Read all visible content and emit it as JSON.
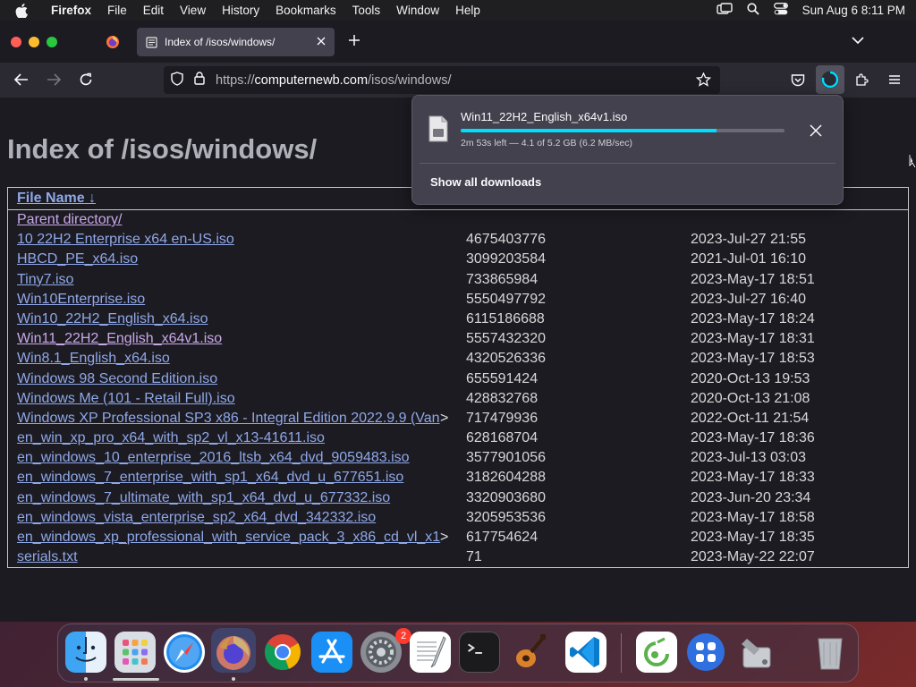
{
  "menubar": {
    "app_name": "Firefox",
    "items": [
      "File",
      "Edit",
      "View",
      "History",
      "Bookmarks",
      "Tools",
      "Window",
      "Help"
    ],
    "clock": "Sun Aug 6  8:11 PM"
  },
  "browser": {
    "tab_title": "Index of /isos/windows/",
    "url_scheme": "https://",
    "url_host": "computernewb.com",
    "url_path": "/isos/windows/"
  },
  "page": {
    "title": "Index of /isos/windows/",
    "column_file_name": "File Name",
    "sort_indicator": "↓",
    "parent_link": "Parent directory/",
    "truncation_marker": ">",
    "rows": [
      {
        "name": "10 22H2 Enterprise x64 en-US.iso",
        "size": "4675403776",
        "date": "2023-Jul-27 21:55",
        "visited": false,
        "truncated": false
      },
      {
        "name": "HBCD_PE_x64.iso",
        "size": "3099203584",
        "date": "2021-Jul-01 16:10",
        "visited": false,
        "truncated": false
      },
      {
        "name": "Tiny7.iso",
        "size": "733865984",
        "date": "2023-May-17 18:51",
        "visited": false,
        "truncated": false
      },
      {
        "name": "Win10Enterprise.iso",
        "size": "5550497792",
        "date": "2023-Jul-27 16:40",
        "visited": false,
        "truncated": false
      },
      {
        "name": "Win10_22H2_English_x64.iso",
        "size": "6115186688",
        "date": "2023-May-17 18:24",
        "visited": false,
        "truncated": false
      },
      {
        "name": "Win11_22H2_English_x64v1.iso",
        "size": "5557432320",
        "date": "2023-May-17 18:31",
        "visited": true,
        "truncated": false
      },
      {
        "name": "Win8.1_English_x64.iso",
        "size": "4320526336",
        "date": "2023-May-17 18:53",
        "visited": false,
        "truncated": false
      },
      {
        "name": "Windows 98 Second Edition.iso",
        "size": "655591424",
        "date": "2020-Oct-13 19:53",
        "visited": false,
        "truncated": false
      },
      {
        "name": "Windows Me (101 - Retail Full).iso",
        "size": "428832768",
        "date": "2020-Oct-13 21:08",
        "visited": false,
        "truncated": false
      },
      {
        "name": "Windows XP Professional SP3 x86 - Integral Edition 2022.9.9 (Van",
        "size": "717479936",
        "date": "2022-Oct-11 21:54",
        "visited": false,
        "truncated": true
      },
      {
        "name": "en_win_xp_pro_x64_with_sp2_vl_x13-41611.iso",
        "size": "628168704",
        "date": "2023-May-17 18:36",
        "visited": false,
        "truncated": false
      },
      {
        "name": "en_windows_10_enterprise_2016_ltsb_x64_dvd_9059483.iso",
        "size": "3577901056",
        "date": "2023-Jul-13 03:03",
        "visited": false,
        "truncated": false
      },
      {
        "name": "en_windows_7_enterprise_with_sp1_x64_dvd_u_677651.iso",
        "size": "3182604288",
        "date": "2023-May-17 18:33",
        "visited": false,
        "truncated": false
      },
      {
        "name": "en_windows_7_ultimate_with_sp1_x64_dvd_u_677332.iso",
        "size": "3320903680",
        "date": "2023-Jun-20 23:34",
        "visited": false,
        "truncated": false
      },
      {
        "name": "en_windows_vista_enterprise_sp2_x64_dvd_342332.iso",
        "size": "3205953536",
        "date": "2023-May-17 18:58",
        "visited": false,
        "truncated": false
      },
      {
        "name": "en_windows_xp_professional_with_service_pack_3_x86_cd_vl_x1",
        "size": "617754624",
        "date": "2023-May-17 18:35",
        "visited": false,
        "truncated": true
      },
      {
        "name": "serials.txt",
        "size": "71",
        "date": "2023-May-22 22:07",
        "visited": false,
        "truncated": false
      }
    ]
  },
  "downloads_panel": {
    "file_name": "Win11_22H2_English_x64v1.iso",
    "progress": 0.79,
    "status": "2m 53s left — 4.1 of 5.2 GB (6.2 MB/sec)",
    "show_all_label": "Show all downloads"
  },
  "dock": {
    "apps": [
      "finder",
      "launchpad",
      "safari",
      "firefox",
      "chrome",
      "app-store",
      "system-settings",
      "textedit",
      "terminal",
      "garageband",
      "vscode",
      "qbittorrent-like",
      "menu-app",
      "system-utility",
      "trash"
    ],
    "system_settings_badge": "2"
  },
  "colors": {
    "link": "#8fa8e8",
    "visited_link": "#c9a8e8",
    "progress_fill": "#00ddff",
    "page_bg": "#1c1b22"
  }
}
